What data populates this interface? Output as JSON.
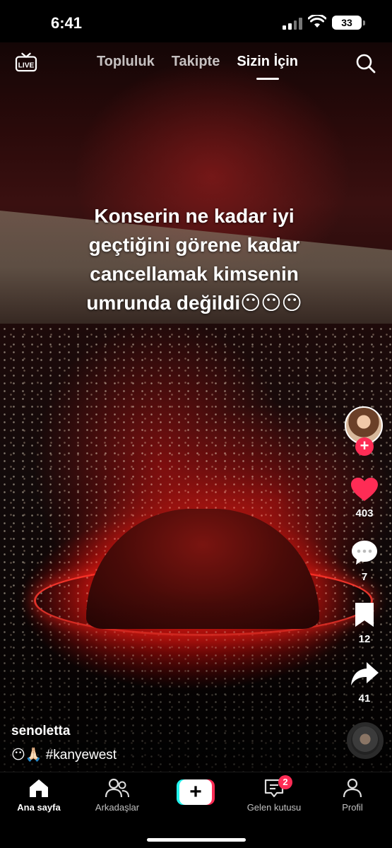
{
  "status_bar": {
    "time": "6:41",
    "battery": "33"
  },
  "top_nav": {
    "live_label": "LIVE",
    "tabs": [
      "Topluluk",
      "Takipte",
      "Sizin İçin"
    ],
    "active_tab": "Sizin İçin"
  },
  "video": {
    "caption_lines": [
      "Konserin ne kadar iyi",
      "geçtiğini görene kadar",
      "cancellamak kimsenin",
      "umrunda değildi😶😶😶"
    ]
  },
  "actions": {
    "likes": "403",
    "comments": "7",
    "saves": "12",
    "shares": "41"
  },
  "post": {
    "username": "senoletta",
    "description": "😶🙏🏻 #kanyewest"
  },
  "bottom_nav": {
    "items": [
      "Ana sayfa",
      "Arkadaşlar",
      "Gelen kutusu",
      "Profil"
    ],
    "inbox_badge": "2"
  },
  "colors": {
    "accent": "#fe2c55",
    "cyan": "#25f4ee",
    "background": "#000000"
  }
}
